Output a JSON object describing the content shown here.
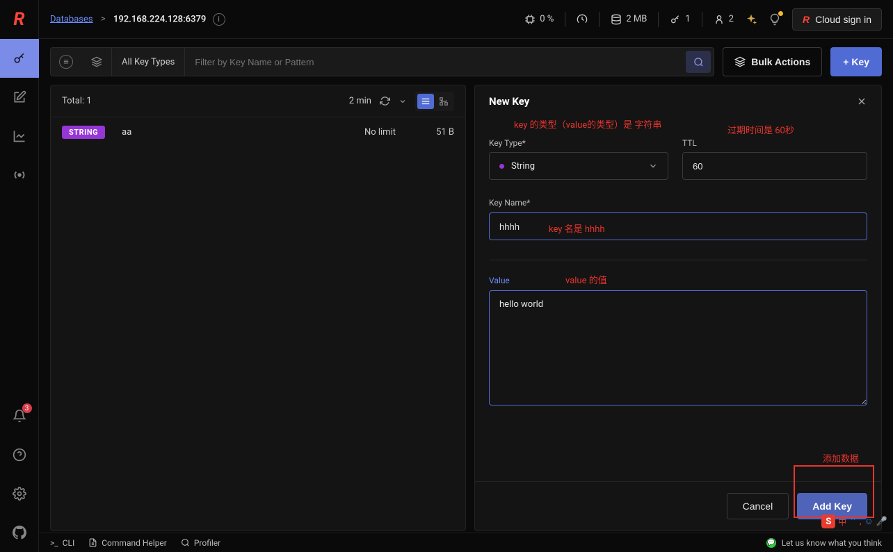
{
  "sidebar": {
    "notification_count": "3"
  },
  "topbar": {
    "breadcrumb_root": "Databases",
    "breadcrumb_current": "192.168.224.128:6379",
    "stats": {
      "cpu": "0 %",
      "memory": "2 MB",
      "keys": "1",
      "clients": "2"
    },
    "cloud_signin": "Cloud sign in"
  },
  "toolbar": {
    "all_key_types": "All Key Types",
    "filter_placeholder": "Filter by Key Name or Pattern",
    "bulk_actions": "Bulk Actions",
    "add_key": "+ Key"
  },
  "keylist": {
    "total_label": "Total:",
    "total_count": "1",
    "last_refresh": "2 min",
    "rows": [
      {
        "type": "STRING",
        "name": "aa",
        "ttl": "No limit",
        "size": "51 B"
      }
    ]
  },
  "newkey": {
    "title": "New Key",
    "key_type_label": "Key Type*",
    "ttl_label": "TTL",
    "key_type_value": "String",
    "ttl_value": "60",
    "key_name_label": "Key Name*",
    "key_name_value": "hhhh",
    "value_label": "Value",
    "value_value": "hello world",
    "cancel": "Cancel",
    "add_key": "Add Key"
  },
  "annotations": {
    "keytype": "key 的类型（value的类型）是 字符串",
    "ttl": "过期时间是 60秒",
    "keyname": "key 名是  hhhh",
    "value": "value 的值",
    "addkey": "添加数据"
  },
  "bottombar": {
    "cli": "CLI",
    "command_helper": "Command Helper",
    "profiler": "Profiler",
    "feedback": "Let us know what you think"
  },
  "ime": {
    "chip": "S",
    "text": "中"
  }
}
